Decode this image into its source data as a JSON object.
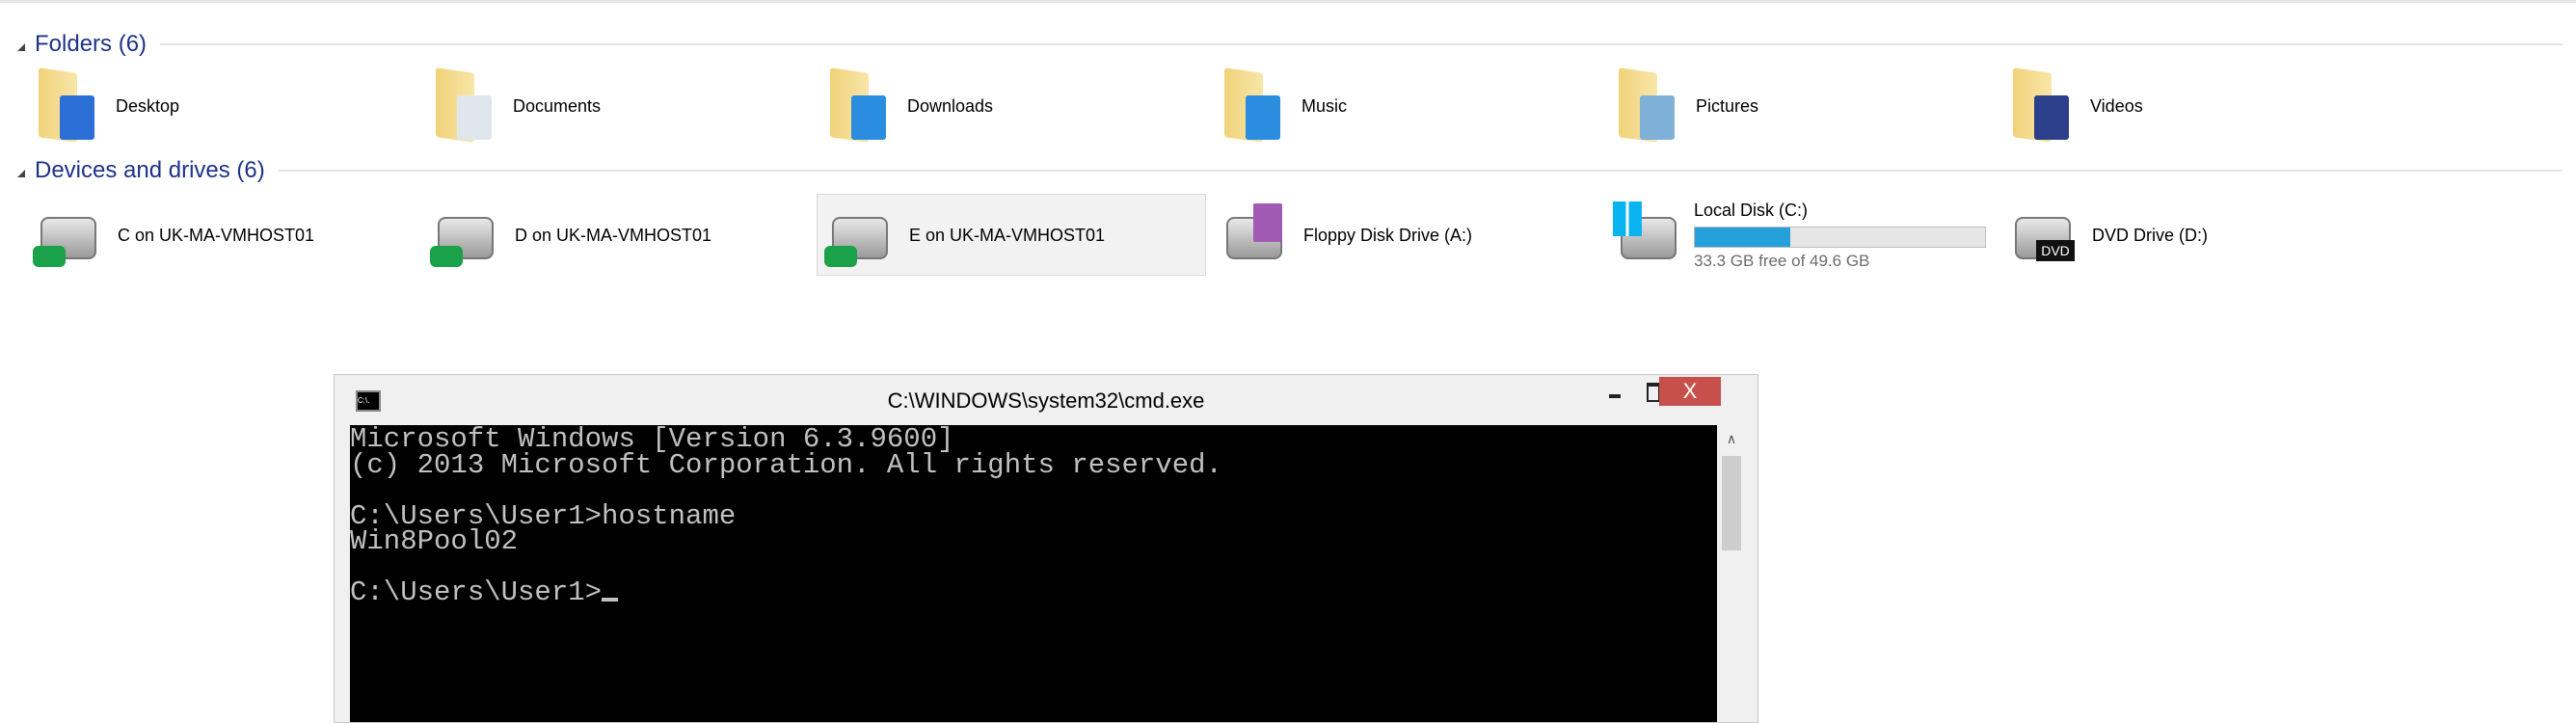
{
  "folders_header": "Folders (6)",
  "folders": [
    {
      "label": "Desktop",
      "icon": "desktop-folder-icon",
      "accent": "#2c6fd6"
    },
    {
      "label": "Documents",
      "icon": "documents-folder-icon",
      "accent": "#dfe6ee"
    },
    {
      "label": "Downloads",
      "icon": "downloads-folder-icon",
      "accent": "#2a8de0"
    },
    {
      "label": "Music",
      "icon": "music-folder-icon",
      "accent": "#2a8de0"
    },
    {
      "label": "Pictures",
      "icon": "pictures-folder-icon",
      "accent": "#7fb0d8"
    },
    {
      "label": "Videos",
      "icon": "videos-folder-icon",
      "accent": "#2b3f8a"
    }
  ],
  "devices_header": "Devices and drives (6)",
  "drives": [
    {
      "label": "C on UK-MA-VMHOST01",
      "icon": "network-drive-icon"
    },
    {
      "label": "D on UK-MA-VMHOST01",
      "icon": "network-drive-icon"
    },
    {
      "label": "E on UK-MA-VMHOST01",
      "icon": "network-drive-icon",
      "selected": true
    },
    {
      "label": "Floppy Disk Drive (A:)",
      "icon": "floppy-drive-icon"
    },
    {
      "label": "Local Disk (C:)",
      "icon": "local-disk-icon",
      "free_text": "33.3 GB free of 49.6 GB",
      "used_fraction": 0.33,
      "bar_color": "#26a0da"
    },
    {
      "label": "DVD Drive (D:)",
      "icon": "dvd-drive-icon",
      "badge": "DVD"
    }
  ],
  "cmd": {
    "title": "C:\\WINDOWS\\system32\\cmd.exe",
    "icon_text": "C:\\.",
    "close_label": "X",
    "lines": [
      "Microsoft Windows [Version 6.3.9600]",
      "(c) 2013 Microsoft Corporation. All rights reserved.",
      "",
      "C:\\Users\\User1>hostname",
      "Win8Pool02",
      "",
      "C:\\Users\\User1>"
    ]
  }
}
